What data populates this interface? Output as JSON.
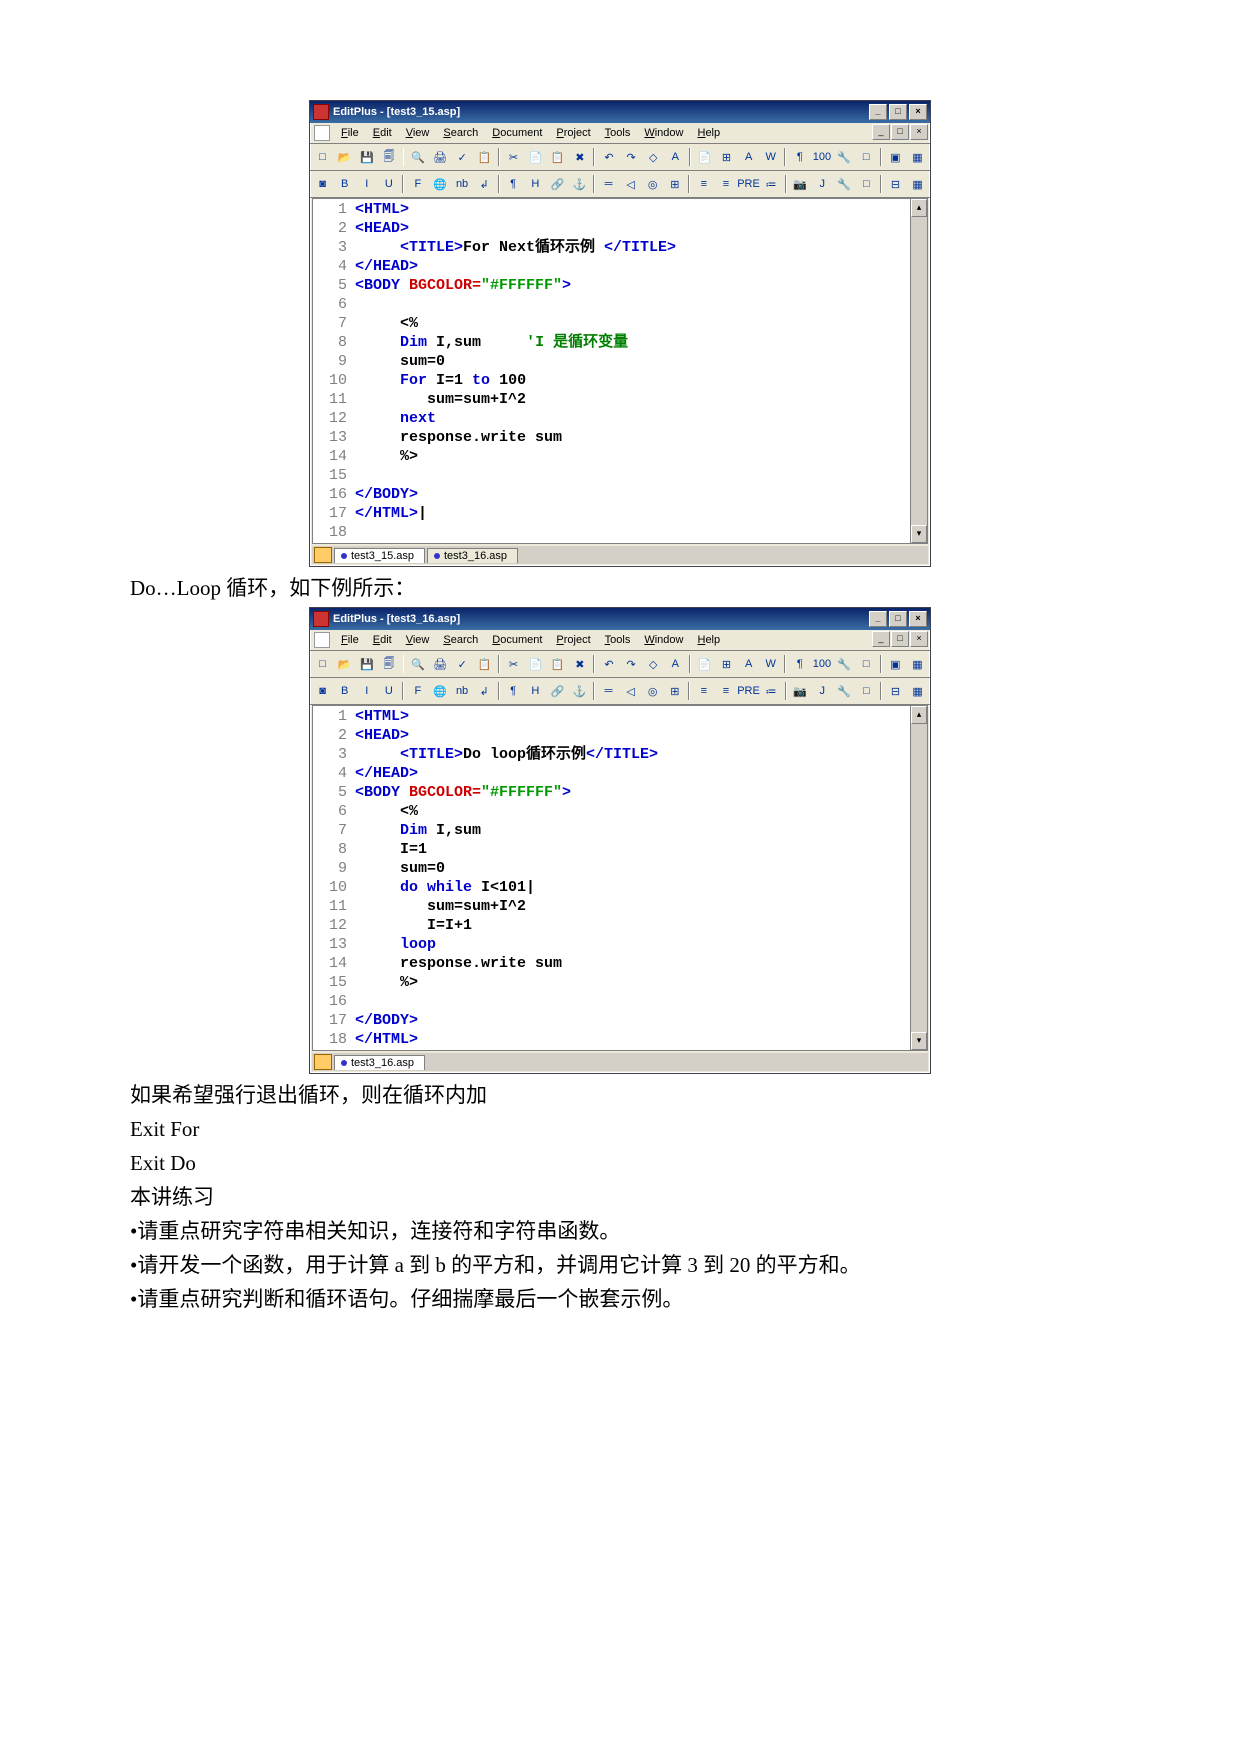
{
  "window1": {
    "title": "EditPlus - [test3_15.asp]",
    "win_minimize": "_",
    "win_maximize": "□",
    "win_close": "×",
    "menu": {
      "file": "File",
      "edit": "Edit",
      "view": "View",
      "search": "Search",
      "document": "Document",
      "project": "Project",
      "tools": "Tools",
      "window": "Window",
      "help": "Help"
    },
    "toolbar1_icons": [
      "□",
      "📂",
      "💾",
      "🗐",
      "🔍",
      "🖨",
      "✓",
      "📋",
      "✂",
      "📄",
      "📋",
      "✖",
      "↶",
      "↷",
      "◇",
      "A",
      "📄",
      "⊞",
      "A",
      "W",
      "¶",
      "100",
      "🔧",
      "□",
      "▣",
      "▦"
    ],
    "toolbar2_icons": [
      "◙",
      "B",
      "I",
      "U",
      "F",
      "🌐",
      "nb",
      "↲",
      "¶",
      "H",
      "🔗",
      "⚓",
      "═",
      "◁",
      "◎",
      "⊞",
      "≡",
      "≡",
      "PRE",
      "≔",
      "📷",
      "J",
      "🔧",
      "□",
      "⊟",
      "▦"
    ],
    "scroll_up": "▴",
    "scroll_down": "▾",
    "code": [
      {
        "n": "1",
        "html": "<span class='k-tag'>&lt;HTML&gt;</span>"
      },
      {
        "n": "2",
        "html": "<span class='k-tag'>&lt;HEAD&gt;</span>"
      },
      {
        "n": "3",
        "html": "     <span class='k-tag'>&lt;TITLE&gt;</span><span class='k-title'>For Next循环示例 </span><span class='k-tag'>&lt;/TITLE&gt;</span>"
      },
      {
        "n": "4",
        "html": "<span class='k-tag'>&lt;/HEAD&gt;</span>"
      },
      {
        "n": "5",
        "html": "<span class='k-tag'>&lt;BODY </span><span class='k-attr'>BGCOLOR=</span><span class='k-string'>\"#FFFFFF\"</span><span class='k-tag'>&gt;</span>"
      },
      {
        "n": "6",
        "html": ""
      },
      {
        "n": "7",
        "html": "     &lt;%"
      },
      {
        "n": "8",
        "html": "     <span class='k-keyword'>Dim</span> I,sum     <span class='k-comment'>'I 是循环变量</span>"
      },
      {
        "n": "9",
        "html": "     sum=0"
      },
      {
        "n": "10",
        "html": "     <span class='k-keyword'>For</span> I=1 <span class='k-keyword'>to</span> 100"
      },
      {
        "n": "11",
        "html": "        sum=sum+I^2"
      },
      {
        "n": "12",
        "html": "     <span class='k-keyword'>next</span>"
      },
      {
        "n": "13",
        "html": "     response.write sum"
      },
      {
        "n": "14",
        "html": "     %&gt;"
      },
      {
        "n": "15",
        "html": ""
      },
      {
        "n": "16",
        "html": "<span class='k-tag'>&lt;/BODY&gt;</span>"
      },
      {
        "n": "17",
        "html": "<span class='k-tag'>&lt;/HTML&gt;</span>|"
      },
      {
        "n": "18",
        "html": ""
      }
    ],
    "tabs": [
      {
        "label": "test3_15.asp",
        "active": true
      },
      {
        "label": "test3_16.asp",
        "active": false
      }
    ]
  },
  "text_between": "Do…Loop 循环，如下例所示：",
  "window2": {
    "title": "EditPlus - [test3_16.asp]",
    "win_minimize": "_",
    "win_maximize": "□",
    "win_close": "×",
    "menu": {
      "file": "File",
      "edit": "Edit",
      "view": "View",
      "search": "Search",
      "document": "Document",
      "project": "Project",
      "tools": "Tools",
      "window": "Window",
      "help": "Help"
    },
    "toolbar1_icons": [
      "□",
      "📂",
      "💾",
      "🗐",
      "🔍",
      "🖨",
      "✓",
      "📋",
      "✂",
      "📄",
      "📋",
      "✖",
      "↶",
      "↷",
      "◇",
      "A",
      "📄",
      "⊞",
      "A",
      "W",
      "¶",
      "100",
      "🔧",
      "□",
      "▣",
      "▦"
    ],
    "toolbar2_icons": [
      "◙",
      "B",
      "I",
      "U",
      "F",
      "🌐",
      "nb",
      "↲",
      "¶",
      "H",
      "🔗",
      "⚓",
      "═",
      "◁",
      "◎",
      "⊞",
      "≡",
      "≡",
      "PRE",
      "≔",
      "📷",
      "J",
      "🔧",
      "□",
      "⊟",
      "▦"
    ],
    "scroll_up": "▴",
    "scroll_down": "▾",
    "code": [
      {
        "n": "1",
        "html": "<span class='k-tag'>&lt;HTML&gt;</span>"
      },
      {
        "n": "2",
        "html": "<span class='k-tag'>&lt;HEAD&gt;</span>"
      },
      {
        "n": "3",
        "html": "     <span class='k-tag'>&lt;TITLE&gt;</span><span class='k-title'>Do loop循环示例</span><span class='k-tag'>&lt;/TITLE&gt;</span>"
      },
      {
        "n": "4",
        "html": "<span class='k-tag'>&lt;/HEAD&gt;</span>"
      },
      {
        "n": "5",
        "html": "<span class='k-tag'>&lt;BODY </span><span class='k-attr'>BGCOLOR=</span><span class='k-string'>\"#FFFFFF\"</span><span class='k-tag'>&gt;</span>"
      },
      {
        "n": "6",
        "html": "     &lt;%"
      },
      {
        "n": "7",
        "html": "     <span class='k-keyword'>Dim</span> I,sum"
      },
      {
        "n": "8",
        "html": "     I=1"
      },
      {
        "n": "9",
        "html": "     sum=0"
      },
      {
        "n": "10",
        "html": "     <span class='k-keyword'>do while</span> I&lt;101|"
      },
      {
        "n": "11",
        "html": "        sum=sum+I^2"
      },
      {
        "n": "12",
        "html": "        I=I+1"
      },
      {
        "n": "13",
        "html": "     <span class='k-keyword'>loop</span>"
      },
      {
        "n": "14",
        "html": "     response.write sum"
      },
      {
        "n": "15",
        "html": "     %&gt;"
      },
      {
        "n": "16",
        "html": ""
      },
      {
        "n": "17",
        "html": "<span class='k-tag'>&lt;/BODY&gt;</span>"
      },
      {
        "n": "18",
        "html": "<span class='k-tag'>&lt;/HTML&gt;</span>"
      }
    ],
    "tabs": [
      {
        "label": "test3_16.asp",
        "active": true
      }
    ]
  },
  "text_after": {
    "line1": "如果希望强行退出循环，则在循环内加",
    "line2": "Exit For",
    "line3": "Exit Do",
    "line4": "本讲练习",
    "bullet1": "•请重点研究字符串相关知识，连接符和字符串函数。",
    "bullet2": "•请开发一个函数，用于计算 a 到 b 的平方和，并调用它计算 3 到 20 的平方和。",
    "bullet3": "•请重点研究判断和循环语句。仔细揣摩最后一个嵌套示例。"
  }
}
